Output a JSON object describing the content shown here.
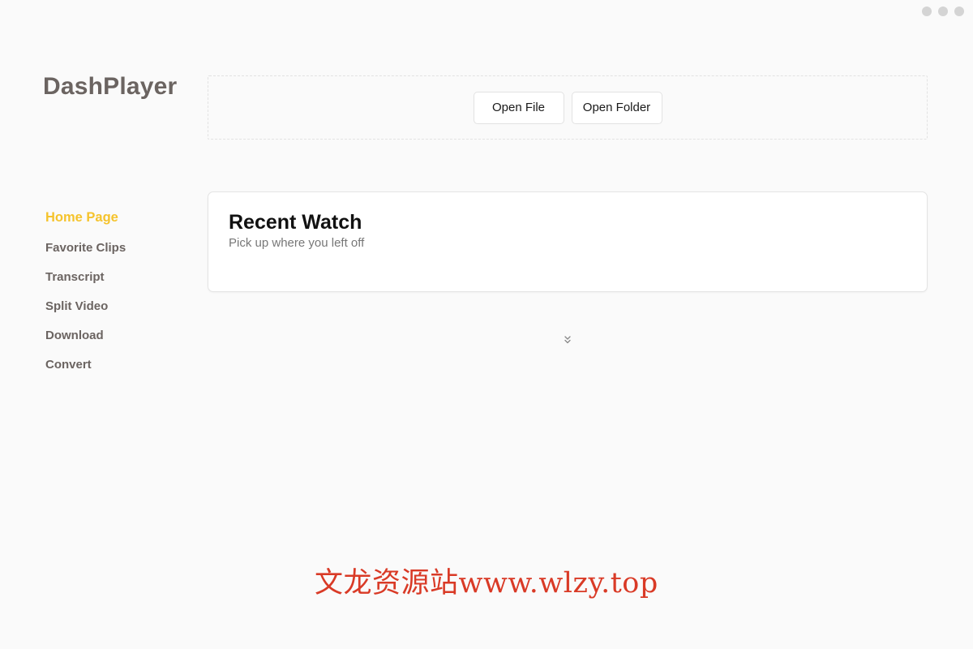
{
  "app": {
    "logo": "DashPlayer"
  },
  "window_controls": [
    "minimize-icon",
    "maximize-icon",
    "close-icon"
  ],
  "sidebar": {
    "items": [
      {
        "label": "Home Page",
        "active": true
      },
      {
        "label": "Favorite Clips",
        "active": false
      },
      {
        "label": "Transcript",
        "active": false
      },
      {
        "label": "Split Video",
        "active": false
      },
      {
        "label": "Download",
        "active": false
      },
      {
        "label": "Convert",
        "active": false
      }
    ]
  },
  "open_area": {
    "open_file_label": "Open File",
    "open_folder_label": "Open Folder"
  },
  "recent_watch": {
    "title": "Recent Watch",
    "subtitle": "Pick up where you left off",
    "expand_icon": "chevrons-down-icon"
  },
  "watermark": {
    "text": "文龙资源站www.wlzy.top"
  },
  "colors": {
    "background": "#fafafa",
    "active_nav": "#f5c32c",
    "nav_text": "#6b6461",
    "watermark": "#d93a26"
  }
}
